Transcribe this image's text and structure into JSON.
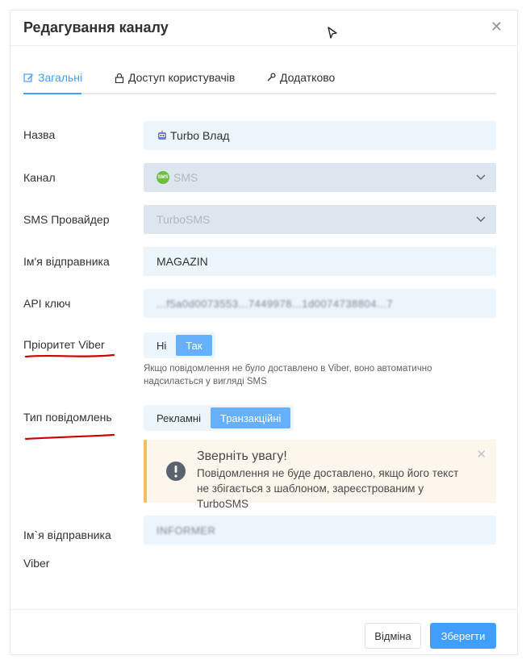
{
  "dialog": {
    "title": "Редагування каналу",
    "close_icon": "close-icon"
  },
  "tabs": [
    {
      "label": "Загальні",
      "icon": "edit-icon",
      "active": true
    },
    {
      "label": "Доступ користувачів",
      "icon": "lock-icon",
      "active": false
    },
    {
      "label": "Додатково",
      "icon": "wrench-icon",
      "active": false
    }
  ],
  "form": {
    "name": {
      "label": "Назва",
      "value": "Turbo Влад",
      "icon": "robot-icon"
    },
    "channel": {
      "label": "Канал",
      "value": "SMS",
      "badge": "SMS"
    },
    "provider": {
      "label": "SMS Провайдер",
      "value": "TurboSMS"
    },
    "sender": {
      "label": "Ім'я відправника",
      "value": "MAGAZIN"
    },
    "api_key": {
      "label": "API ключ",
      "value": "...f5a0d0073553...7449978...1d0074738804...7"
    },
    "viber_priority": {
      "label": "Пріоритет Viber",
      "options": [
        "Ні",
        "Так"
      ],
      "selected": "Так",
      "hint": "Якщо повідомлення не було доставлено в Viber, воно автоматично надсилається у вигляді SMS"
    },
    "message_type": {
      "label": "Тип повідомлень",
      "options": [
        "Рекламні",
        "Транзакційні"
      ],
      "selected": "Транзакційні"
    },
    "alert": {
      "title": "Зверніть увагу!",
      "text": "Повідомлення не буде доставлено, якщо його текст не збігається з шаблоном, зареєстрованим у TurboSMS"
    },
    "viber_sender": {
      "label": "Ім`я відправника Viber",
      "value": "INFORMER"
    }
  },
  "footer": {
    "cancel_label": "Відміна",
    "save_label": "Зберегти"
  },
  "colors": {
    "accent": "#409eff",
    "field_bg": "#ecf5fc",
    "alert_bg": "#fdf6ec",
    "alert_border": "#f0c060",
    "annotation_red": "#cc0000"
  }
}
